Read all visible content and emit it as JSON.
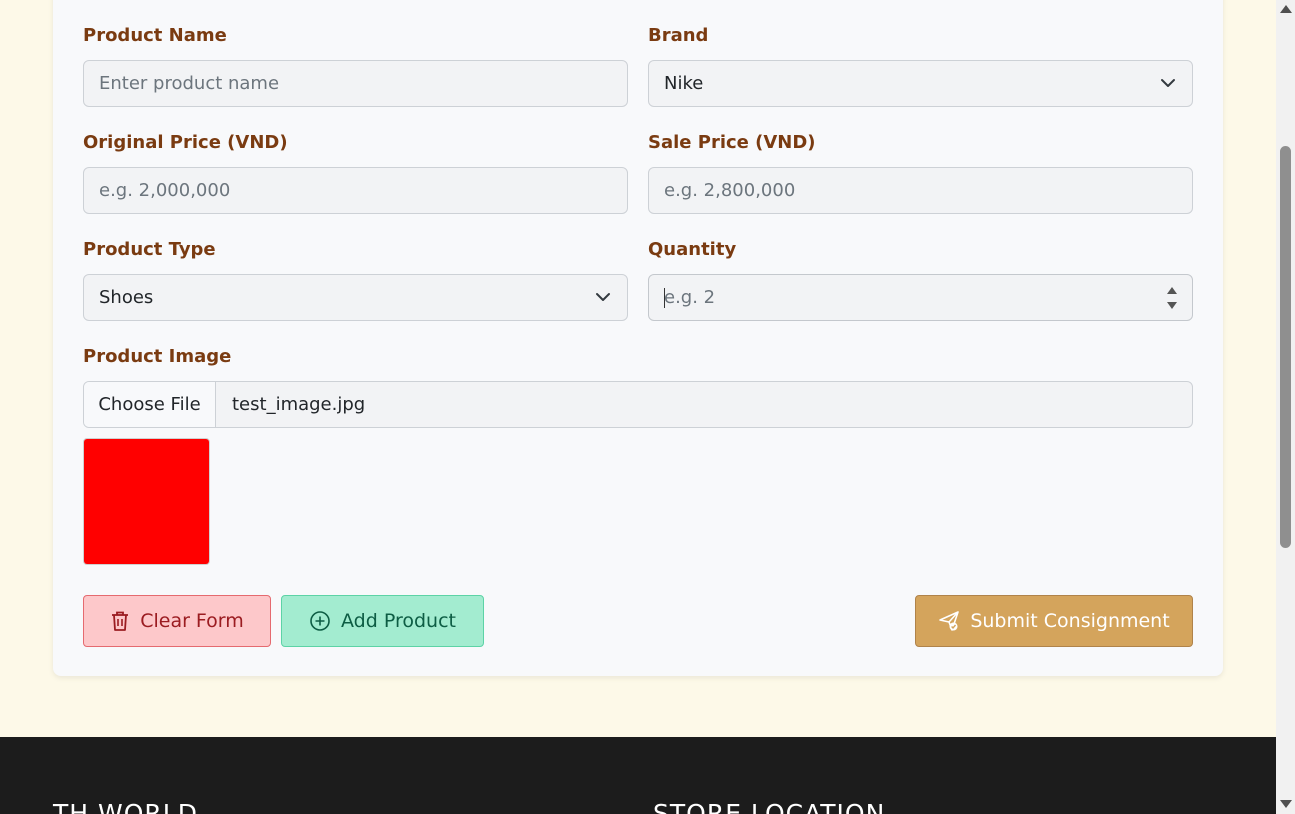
{
  "form": {
    "product_name": {
      "label": "Product Name",
      "placeholder": "Enter product name",
      "value": ""
    },
    "brand": {
      "label": "Brand",
      "selected": "Nike"
    },
    "original_price": {
      "label": "Original Price (VND)",
      "placeholder": "e.g. 2,000,000",
      "value": ""
    },
    "sale_price": {
      "label": "Sale Price (VND)",
      "placeholder": "e.g. 2,800,000",
      "value": ""
    },
    "product_type": {
      "label": "Product Type",
      "selected": "Shoes"
    },
    "quantity": {
      "label": "Quantity",
      "placeholder": "e.g. 2",
      "value": ""
    },
    "product_image": {
      "label": "Product Image",
      "choose_button": "Choose File",
      "file_name": "test_image.jpg",
      "preview_color": "#ff0000"
    }
  },
  "actions": {
    "clear_label": "Clear Form",
    "add_label": "Add Product",
    "submit_label": "Submit Consignment"
  },
  "footer": {
    "brand_heading": "TH WORLD",
    "store_heading": "STORE LOCATION"
  },
  "icons": {
    "brand_chevron": "chevron-down-icon",
    "type_chevron": "chevron-down-icon",
    "quantity_spinner": "number-spinner-icon",
    "clear": "trash-icon",
    "add": "plus-circle-icon",
    "submit": "send-icon"
  },
  "colors": {
    "page_background": "#fdf9e8",
    "label_text": "#7a3b11",
    "clear_button": "#fdc8ca",
    "add_button": "#a3ecd0",
    "submit_button": "#d4a45c",
    "footer_background": "#1c1c1c"
  }
}
